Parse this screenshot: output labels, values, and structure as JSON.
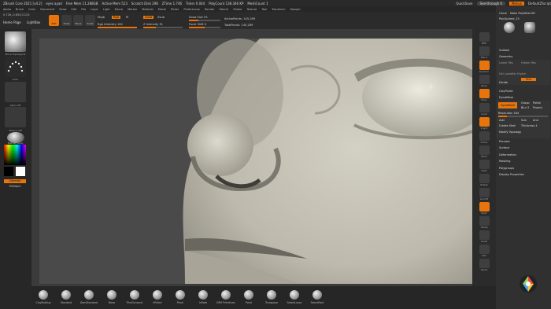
{
  "titlebar": {
    "app": "ZBrush Core 2021 [v4.2]",
    "doc": "eyes ayad",
    "free_mem": "Free Mem 11.288GB",
    "active_mem": "Active Mem 523",
    "scratch_disk": "Scratch Disk 298",
    "ztime": "ZTime 1.746",
    "timer": "Timer 0.044",
    "poly_count": "PolyCount 138.346 KP",
    "mesh_count": "MeshCount 1",
    "quicksave": "QuickSave",
    "see_through": "See-through 0",
    "menus": "Menus",
    "default_zscript": "DefaultZScript"
  },
  "menubar": [
    "Alpha",
    "Brush",
    "Color",
    "Document",
    "Draw",
    "Edit",
    "File",
    "Layer",
    "Light",
    "Macro",
    "Marker",
    "Material",
    "Movie",
    "Picker",
    "Preferences",
    "Render",
    "Stencil",
    "Stroke",
    "Texture",
    "Tool",
    "Transform",
    "Zplugin"
  ],
  "toolbar": {
    "coords": "0.726,-0.654,0.224",
    "home_page": "Home Page",
    "lightbox": "LightBox",
    "edit": "Edit",
    "draw": "Draw",
    "move": "Move",
    "scale": "Scale",
    "rotate": "Rotate",
    "mrgb": "Mrgb",
    "rgb": "Rgb",
    "m": "M",
    "zadd": "Zadd",
    "zsub": "Zsub",
    "rgb_intensity": "Rgb Intensity 100",
    "z_intensity": "Z Intensity 31",
    "draw_size": "Draw Size 55",
    "focal_shift": "Focal Shift 0",
    "active_points": "ActivePoints: 145,289",
    "total_points": "TotalPoints: 145,289"
  },
  "leftshelf": {
    "move_topological": "Move Topological",
    "dots": "Dots",
    "alpha_off": "Alpha Off",
    "texture_off": "Texture Off",
    "matcap_gray": "MatCap Gray",
    "alternate": "Alternate",
    "fill_object": "FillObject"
  },
  "rightstrip": [
    "BPR",
    "SPix 3",
    "Dynamic",
    "Persp",
    "Floor",
    "Local",
    "L.Sym",
    "Frame",
    "Move",
    "Scale",
    "Rotate",
    "Line Fill",
    "PolyF",
    "Transp",
    "Ghost",
    "Solo",
    "Xpose"
  ],
  "rightpanel": {
    "clone": "Clone",
    "make_polymesh": "Make PolyMesh3D",
    "polysphere": "PolySphere_15",
    "subtool": "Subtool",
    "geometry": "Geometry",
    "lower_res": "Lower Res",
    "higher_res": "Higher Res",
    "del_lower": "Del Lower",
    "del_higher": "Del Higher",
    "smt": "Smt",
    "divide": "Divide",
    "claypolish": "ClayPolish",
    "dynamesh": "DynaMesh",
    "dynamesh_btn": "DynaMesh",
    "group": "Group",
    "polish": "Polish",
    "blur": "Blur 2",
    "project": "Project",
    "resolution": "Resolution 184",
    "add": "Add",
    "sub": "Sub",
    "and": "And",
    "create_shell": "Create Shell",
    "thickness": "Thickness 4",
    "modify_topology": "Modify Topology",
    "preview": "Preview",
    "surface": "Surface",
    "deformation": "Deformation",
    "masking": "Masking",
    "polygroups": "Polygroups",
    "display_properties": "Display Properties"
  },
  "bottombar": [
    "ClayBuildup",
    "Standard",
    "DamStandard",
    "Move",
    "TrimDynamic",
    "hPolish",
    "Pinch",
    "Inflate",
    "IMM Primitives",
    "Paint",
    "Transpose",
    "SelectLasso",
    "SelectRect"
  ]
}
